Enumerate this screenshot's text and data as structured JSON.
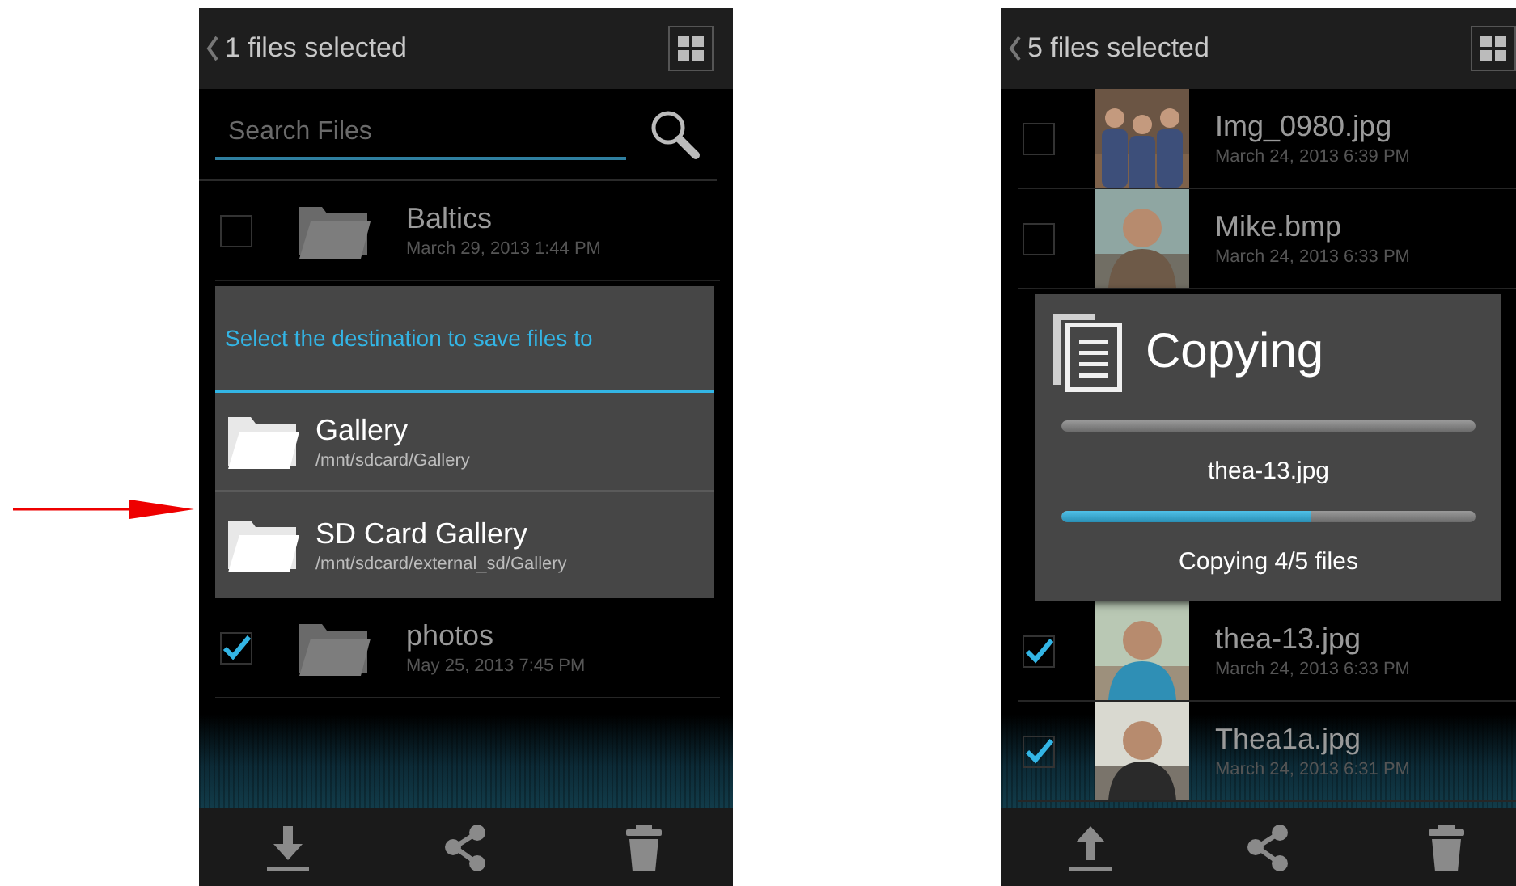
{
  "screens": [
    {
      "title": "1 files selected",
      "search": {
        "placeholder": "Search Files"
      },
      "rows_above": [
        {
          "kind": "folder",
          "name": "Baltics",
          "date": "March 29, 2013 1:44 PM",
          "checked": false
        }
      ],
      "dialog": {
        "kind": "destination",
        "title": "Select the destination to save files to",
        "items": [
          {
            "name": "Gallery",
            "path": "/mnt/sdcard/Gallery"
          },
          {
            "name": "SD Card Gallery",
            "path": "/mnt/sdcard/external_sd/Gallery"
          }
        ]
      },
      "rows_below": [
        {
          "kind": "folder",
          "name": "photos",
          "date": "May 25, 2013 7:45 PM",
          "checked": true
        }
      ],
      "toolbar": [
        {
          "kind": "download"
        },
        {
          "kind": "share"
        },
        {
          "kind": "delete"
        }
      ]
    },
    {
      "title": "5 files selected",
      "rows_above": [
        {
          "name": "Img_0980.jpg",
          "date": "March 24, 2013 6:39 PM",
          "checked": false
        },
        {
          "name": "Mike.bmp",
          "date": "March 24, 2013 6:33 PM",
          "checked": false
        }
      ],
      "dialog": {
        "kind": "progress",
        "title": "Copying",
        "items": [
          {
            "kind": "bar",
            "level": 0
          },
          {
            "kind": "text",
            "text": "thea-13.jpg"
          },
          {
            "kind": "bar",
            "level": 0.6
          },
          {
            "kind": "text",
            "text": "Copying 4/5 files"
          }
        ]
      },
      "rows_below": [
        {
          "name": "thea-13.jpg",
          "date": "March 24, 2013 6:33 PM",
          "checked": true
        },
        {
          "name": "Thea1a.jpg",
          "date": "March 24, 2013 6:31 PM",
          "checked": true
        }
      ],
      "toolbar": [
        {
          "kind": "upload"
        },
        {
          "kind": "share"
        },
        {
          "kind": "delete"
        }
      ]
    }
  ]
}
